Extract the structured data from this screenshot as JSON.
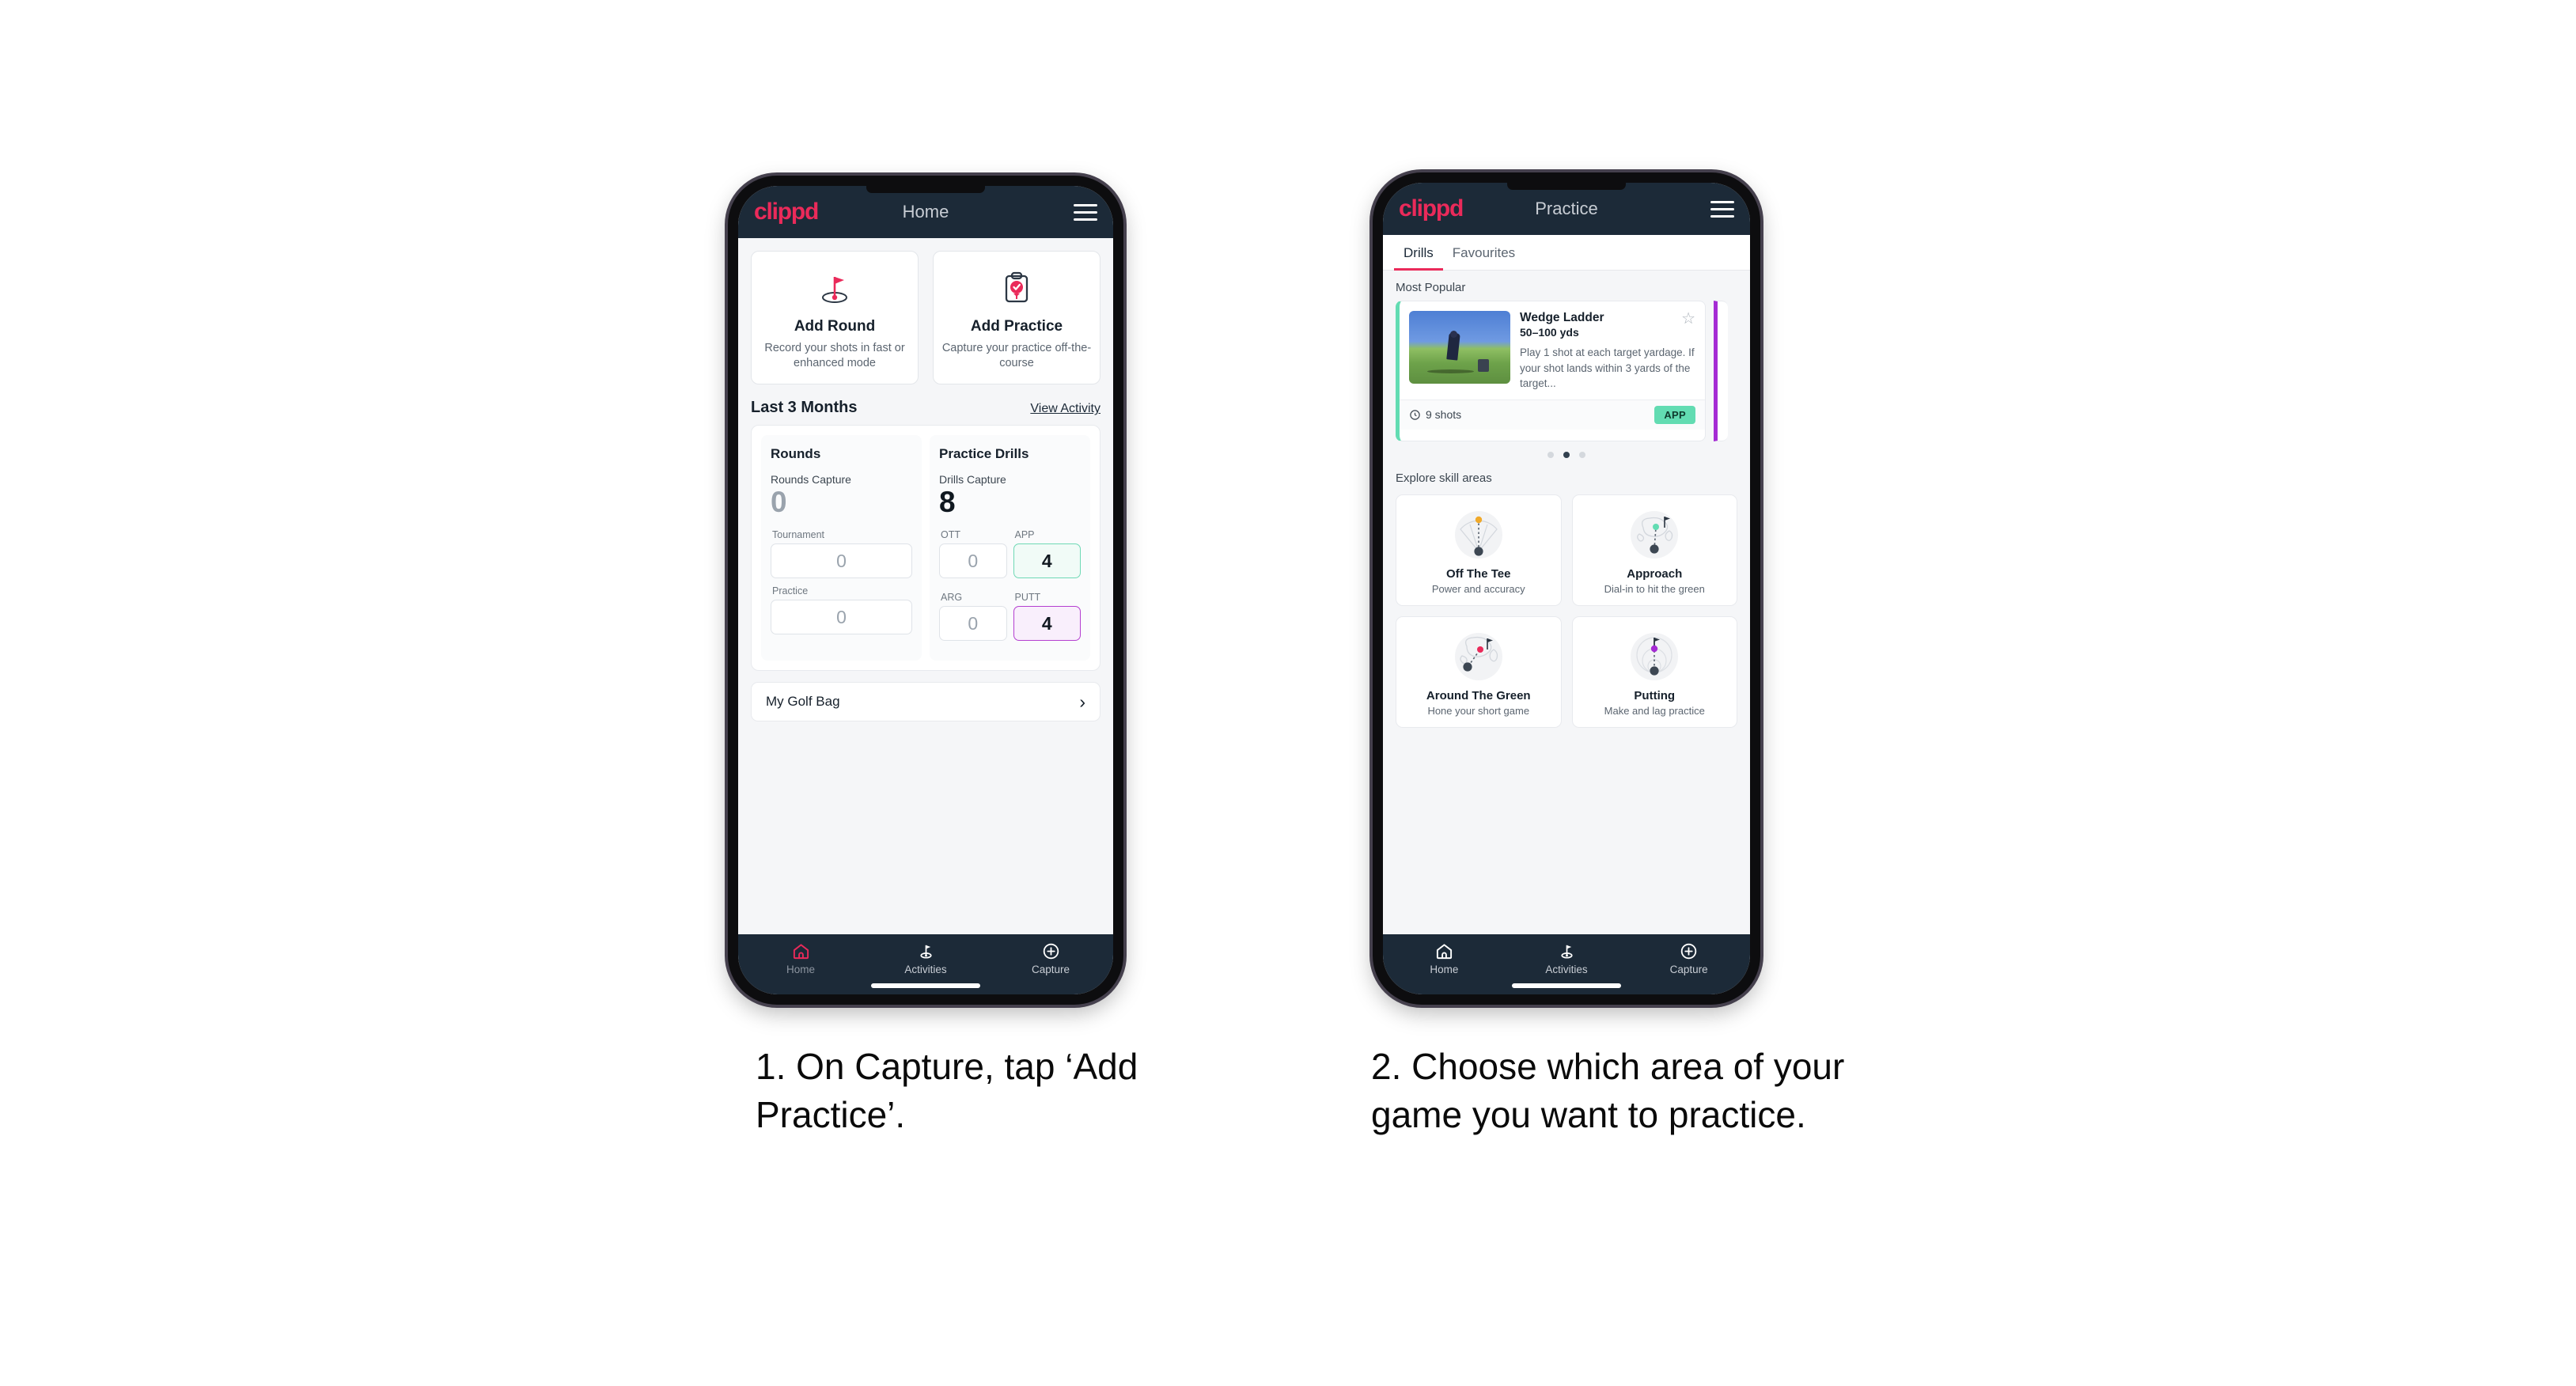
{
  "phone1": {
    "appbar": {
      "brand": "clippd",
      "title": "Home",
      "menu_icon": "hamburger-icon"
    },
    "quick_actions": [
      {
        "icon": "golf-flag-hole-icon",
        "title": "Add Round",
        "subtitle": "Record your shots in fast or enhanced mode"
      },
      {
        "icon": "clipboard-check-tee-icon",
        "title": "Add Practice",
        "subtitle": "Capture your practice off-the-course"
      }
    ],
    "section": {
      "title": "Last 3 Months",
      "link": "View Activity"
    },
    "rounds": {
      "heading": "Rounds",
      "capture_label": "Rounds Capture",
      "capture_value": "0",
      "fields": [
        {
          "label": "Tournament",
          "value": "0",
          "state": "empty"
        },
        {
          "label": "Practice",
          "value": "0",
          "state": "empty"
        }
      ]
    },
    "drills": {
      "heading": "Practice Drills",
      "capture_label": "Drills Capture",
      "capture_value": "8",
      "fields": [
        {
          "label": "OTT",
          "value": "0",
          "state": "empty"
        },
        {
          "label": "APP",
          "value": "4",
          "state": "app"
        },
        {
          "label": "ARG",
          "value": "0",
          "state": "empty"
        },
        {
          "label": "PUTT",
          "value": "4",
          "state": "putt"
        }
      ]
    },
    "golf_bag": {
      "label": "My Golf Bag",
      "chevron": "chevron-right-icon"
    },
    "bottom_nav": [
      {
        "icon": "home-icon",
        "label": "Home",
        "active": true
      },
      {
        "icon": "golf-flag-icon",
        "label": "Activities",
        "active": false
      },
      {
        "icon": "plus-circle-icon",
        "label": "Capture",
        "active": false
      }
    ]
  },
  "phone2": {
    "appbar": {
      "brand": "clippd",
      "title": "Practice",
      "menu_icon": "hamburger-icon"
    },
    "tabs": [
      {
        "label": "Drills",
        "active": true
      },
      {
        "label": "Favourites",
        "active": false
      }
    ],
    "most_popular_label": "Most Popular",
    "drill_card": {
      "title": "Wedge Ladder",
      "yardage": "50–100 yds",
      "description": "Play 1 shot at each target yardage. If your shot lands within 3 yards of the target...",
      "shots": "9 shots",
      "shots_icon": "clock-icon",
      "badge": "APP",
      "favourite_icon": "star-outline-icon"
    },
    "carousel_dots": {
      "count": 3,
      "active_index": 1
    },
    "explore_label": "Explore skill areas",
    "skill_areas": [
      {
        "icon": "tee-shot-fan-icon",
        "title": "Off The Tee",
        "subtitle": "Power and accuracy"
      },
      {
        "icon": "approach-green-icon",
        "title": "Approach",
        "subtitle": "Dial-in to hit the green"
      },
      {
        "icon": "chip-green-icon",
        "title": "Around The Green",
        "subtitle": "Hone your short game"
      },
      {
        "icon": "putting-rings-icon",
        "title": "Putting",
        "subtitle": "Make and lag practice"
      }
    ],
    "bottom_nav": [
      {
        "icon": "home-icon",
        "label": "Home",
        "active": false
      },
      {
        "icon": "golf-flag-icon",
        "label": "Activities",
        "active": false
      },
      {
        "icon": "plus-circle-icon",
        "label": "Capture",
        "active": false
      }
    ]
  },
  "captions": {
    "step1": "1. On Capture, tap ‘Add Practice’.",
    "step2": "2. Choose which area of your game you want to practice."
  },
  "colors": {
    "brand_pink": "#ea2a5a",
    "navy": "#1c2a38",
    "app_green": "#62dcb2",
    "putt_purple": "#b43fd0",
    "page_bg": "#f5f6f8"
  }
}
